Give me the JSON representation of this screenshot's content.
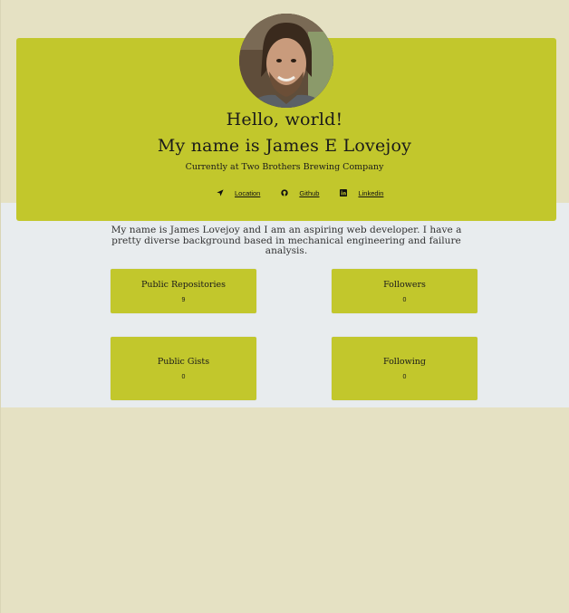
{
  "header": {
    "greeting": "Hello, world!",
    "name_line": "My name is James E Lovejoy",
    "currently": "Currently at Two Brothers Brewing Company"
  },
  "links": [
    {
      "label": "Location",
      "icon": "location-arrow-icon"
    },
    {
      "label": "Github",
      "icon": "github-icon"
    },
    {
      "label": "Linkedin",
      "icon": "linkedin-icon"
    }
  ],
  "bio": "My name is James Lovejoy and I am an aspiring web developer. I have a pretty diverse background based in mechanical engineering and failure analysis.",
  "stats": {
    "public_repositories": {
      "label": "Public Repositories",
      "value": "9"
    },
    "followers": {
      "label": "Followers",
      "value": "0"
    },
    "public_gists": {
      "label": "Public Gists",
      "value": "0"
    },
    "following": {
      "label": "Following",
      "value": "0"
    }
  },
  "colors": {
    "page_background": "#e5e1c3",
    "band_background": "#e8ecee",
    "accent": "#c2c72c"
  }
}
